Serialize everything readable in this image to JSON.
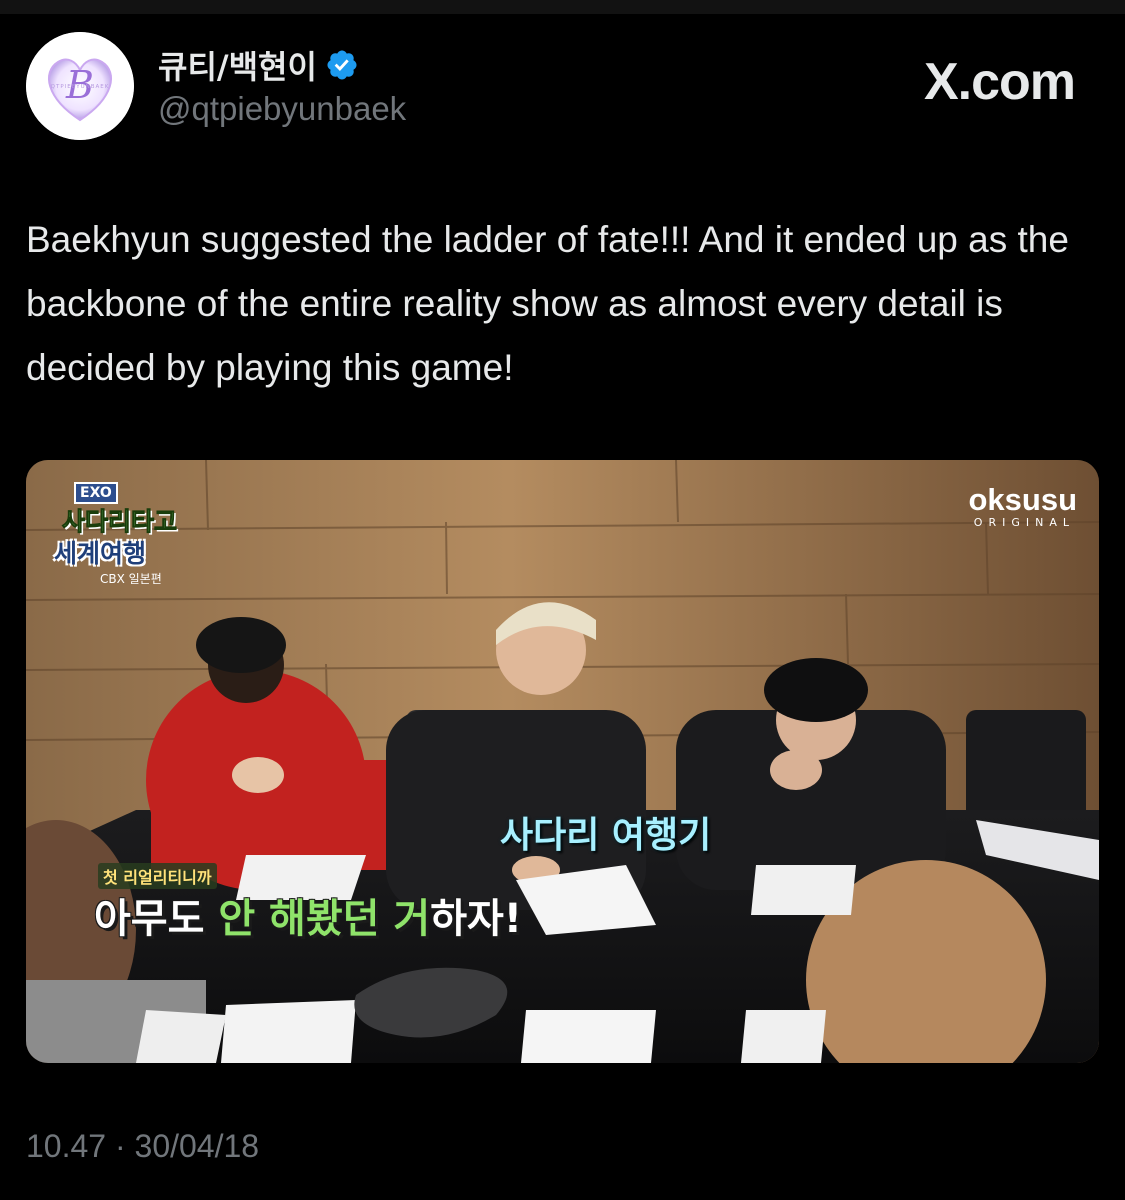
{
  "colors": {
    "background": "#000000",
    "text_primary": "#e7e9ea",
    "text_secondary": "#71767b",
    "verified_blue": "#1d9bf0"
  },
  "author": {
    "display_name": "큐티/백현이",
    "handle": "@qtpiebyunbaek",
    "verified": true,
    "avatar_letter": "B",
    "avatar_ring_text": "QTPIEBYUNBAEK"
  },
  "site_label": "X.com",
  "tweet": {
    "text": "Baekhyun suggested the ladder of fate!!! And it ended up as the backbone of the entire reality show as almost every detail is decided by playing this game!",
    "time": "10.47",
    "separator": "·",
    "date": "30/04/18"
  },
  "media": {
    "show_tag": "EXO",
    "show_title_line1": "사다리타고",
    "show_title_line2": "세계여행",
    "show_subtitle": "CBX 일본편",
    "brand": "oksusu",
    "brand_sub": "ORIGINAL",
    "caption_speech": "사다리 여행기",
    "caption_small": "첫 리얼리티니까",
    "caption_main_parts": [
      "아무도 ",
      "안 해봤던 ",
      "거",
      "하자!"
    ]
  },
  "icons": [
    "verified-badge-icon"
  ]
}
